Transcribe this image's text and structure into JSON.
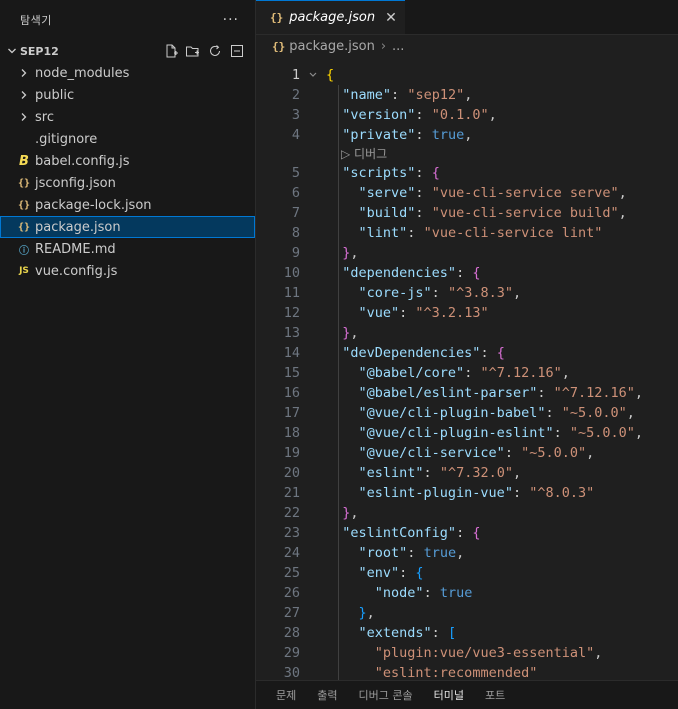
{
  "explorer": {
    "title": "탐색기",
    "more": "···",
    "folder": "SEP12",
    "items": [
      {
        "label": "node_modules",
        "icon": "chevron-right-icon",
        "glyph": "›",
        "kind": "folder"
      },
      {
        "label": "public",
        "icon": "chevron-right-icon",
        "glyph": "›",
        "kind": "folder"
      },
      {
        "label": "src",
        "icon": "chevron-right-icon",
        "glyph": "›",
        "kind": "folder"
      },
      {
        "label": ".gitignore",
        "icon": "",
        "glyph": "",
        "kind": "file"
      },
      {
        "label": "babel.config.js",
        "icon": "babel-icon",
        "glyph": "B",
        "kind": "babel"
      },
      {
        "label": "jsconfig.json",
        "icon": "json-icon",
        "glyph": "{}",
        "kind": "json"
      },
      {
        "label": "package-lock.json",
        "icon": "json-icon",
        "glyph": "{}",
        "kind": "json"
      },
      {
        "label": "package.json",
        "icon": "json-icon",
        "glyph": "{}",
        "kind": "json",
        "selected": true
      },
      {
        "label": "README.md",
        "icon": "info-icon",
        "glyph": "ⓘ",
        "kind": "info"
      },
      {
        "label": "vue.config.js",
        "icon": "js-icon",
        "glyph": "JS",
        "kind": "js"
      }
    ]
  },
  "editor": {
    "tab": {
      "label": "package.json",
      "icon_text": "{}",
      "close": "✕"
    },
    "breadcrumb": {
      "icon_text": "{}",
      "file": "package.json",
      "rest": "..."
    },
    "codelens": "▷ 디버그",
    "active_line": "1"
  },
  "panel": {
    "tabs": [
      "문제",
      "출력",
      "디버그 콘솔",
      "터미널",
      "포트"
    ],
    "active": "터미널"
  },
  "code_lines": [
    {
      "n": "1",
      "t": [
        [
          "br1",
          "{"
        ]
      ]
    },
    {
      "n": "2",
      "t": [
        [
          "p",
          "  "
        ],
        [
          "k",
          "\"name\""
        ],
        [
          "p",
          ": "
        ],
        [
          "s",
          "\"sep12\""
        ],
        [
          "p",
          ","
        ]
      ]
    },
    {
      "n": "3",
      "t": [
        [
          "p",
          "  "
        ],
        [
          "k",
          "\"version\""
        ],
        [
          "p",
          ": "
        ],
        [
          "s",
          "\"0.1.0\""
        ],
        [
          "p",
          ","
        ]
      ]
    },
    {
      "n": "4",
      "t": [
        [
          "p",
          "  "
        ],
        [
          "k",
          "\"private\""
        ],
        [
          "p",
          ": "
        ],
        [
          "b",
          "true"
        ],
        [
          "p",
          ","
        ]
      ]
    },
    {
      "lens": true
    },
    {
      "n": "5",
      "t": [
        [
          "p",
          "  "
        ],
        [
          "k",
          "\"scripts\""
        ],
        [
          "p",
          ": "
        ],
        [
          "br2",
          "{"
        ]
      ]
    },
    {
      "n": "6",
      "t": [
        [
          "p",
          "    "
        ],
        [
          "k",
          "\"serve\""
        ],
        [
          "p",
          ": "
        ],
        [
          "s",
          "\"vue-cli-service serve\""
        ],
        [
          "p",
          ","
        ]
      ]
    },
    {
      "n": "7",
      "t": [
        [
          "p",
          "    "
        ],
        [
          "k",
          "\"build\""
        ],
        [
          "p",
          ": "
        ],
        [
          "s",
          "\"vue-cli-service build\""
        ],
        [
          "p",
          ","
        ]
      ]
    },
    {
      "n": "8",
      "t": [
        [
          "p",
          "    "
        ],
        [
          "k",
          "\"lint\""
        ],
        [
          "p",
          ": "
        ],
        [
          "s",
          "\"vue-cli-service lint\""
        ]
      ]
    },
    {
      "n": "9",
      "t": [
        [
          "p",
          "  "
        ],
        [
          "br2",
          "}"
        ],
        [
          "p",
          ","
        ]
      ]
    },
    {
      "n": "10",
      "t": [
        [
          "p",
          "  "
        ],
        [
          "k",
          "\"dependencies\""
        ],
        [
          "p",
          ": "
        ],
        [
          "br2",
          "{"
        ]
      ]
    },
    {
      "n": "11",
      "t": [
        [
          "p",
          "    "
        ],
        [
          "k",
          "\"core-js\""
        ],
        [
          "p",
          ": "
        ],
        [
          "s",
          "\"^3.8.3\""
        ],
        [
          "p",
          ","
        ]
      ]
    },
    {
      "n": "12",
      "t": [
        [
          "p",
          "    "
        ],
        [
          "k",
          "\"vue\""
        ],
        [
          "p",
          ": "
        ],
        [
          "s",
          "\"^3.2.13\""
        ]
      ]
    },
    {
      "n": "13",
      "t": [
        [
          "p",
          "  "
        ],
        [
          "br2",
          "}"
        ],
        [
          "p",
          ","
        ]
      ]
    },
    {
      "n": "14",
      "t": [
        [
          "p",
          "  "
        ],
        [
          "k",
          "\"devDependencies\""
        ],
        [
          "p",
          ": "
        ],
        [
          "br2",
          "{"
        ]
      ]
    },
    {
      "n": "15",
      "t": [
        [
          "p",
          "    "
        ],
        [
          "k",
          "\"@babel/core\""
        ],
        [
          "p",
          ": "
        ],
        [
          "s",
          "\"^7.12.16\""
        ],
        [
          "p",
          ","
        ]
      ]
    },
    {
      "n": "16",
      "t": [
        [
          "p",
          "    "
        ],
        [
          "k",
          "\"@babel/eslint-parser\""
        ],
        [
          "p",
          ": "
        ],
        [
          "s",
          "\"^7.12.16\""
        ],
        [
          "p",
          ","
        ]
      ]
    },
    {
      "n": "17",
      "t": [
        [
          "p",
          "    "
        ],
        [
          "k",
          "\"@vue/cli-plugin-babel\""
        ],
        [
          "p",
          ": "
        ],
        [
          "s",
          "\"~5.0.0\""
        ],
        [
          "p",
          ","
        ]
      ]
    },
    {
      "n": "18",
      "t": [
        [
          "p",
          "    "
        ],
        [
          "k",
          "\"@vue/cli-plugin-eslint\""
        ],
        [
          "p",
          ": "
        ],
        [
          "s",
          "\"~5.0.0\""
        ],
        [
          "p",
          ","
        ]
      ]
    },
    {
      "n": "19",
      "t": [
        [
          "p",
          "    "
        ],
        [
          "k",
          "\"@vue/cli-service\""
        ],
        [
          "p",
          ": "
        ],
        [
          "s",
          "\"~5.0.0\""
        ],
        [
          "p",
          ","
        ]
      ]
    },
    {
      "n": "20",
      "t": [
        [
          "p",
          "    "
        ],
        [
          "k",
          "\"eslint\""
        ],
        [
          "p",
          ": "
        ],
        [
          "s",
          "\"^7.32.0\""
        ],
        [
          "p",
          ","
        ]
      ]
    },
    {
      "n": "21",
      "t": [
        [
          "p",
          "    "
        ],
        [
          "k",
          "\"eslint-plugin-vue\""
        ],
        [
          "p",
          ": "
        ],
        [
          "s",
          "\"^8.0.3\""
        ]
      ]
    },
    {
      "n": "22",
      "t": [
        [
          "p",
          "  "
        ],
        [
          "br2",
          "}"
        ],
        [
          "p",
          ","
        ]
      ]
    },
    {
      "n": "23",
      "t": [
        [
          "p",
          "  "
        ],
        [
          "k",
          "\"eslintConfig\""
        ],
        [
          "p",
          ": "
        ],
        [
          "br2",
          "{"
        ]
      ]
    },
    {
      "n": "24",
      "t": [
        [
          "p",
          "    "
        ],
        [
          "k",
          "\"root\""
        ],
        [
          "p",
          ": "
        ],
        [
          "b",
          "true"
        ],
        [
          "p",
          ","
        ]
      ]
    },
    {
      "n": "25",
      "t": [
        [
          "p",
          "    "
        ],
        [
          "k",
          "\"env\""
        ],
        [
          "p",
          ": "
        ],
        [
          "br3",
          "{"
        ]
      ]
    },
    {
      "n": "26",
      "t": [
        [
          "p",
          "      "
        ],
        [
          "k",
          "\"node\""
        ],
        [
          "p",
          ": "
        ],
        [
          "b",
          "true"
        ]
      ]
    },
    {
      "n": "27",
      "t": [
        [
          "p",
          "    "
        ],
        [
          "br3",
          "}"
        ],
        [
          "p",
          ","
        ]
      ]
    },
    {
      "n": "28",
      "t": [
        [
          "p",
          "    "
        ],
        [
          "k",
          "\"extends\""
        ],
        [
          "p",
          ": "
        ],
        [
          "br3",
          "["
        ]
      ]
    },
    {
      "n": "29",
      "t": [
        [
          "p",
          "      "
        ],
        [
          "s",
          "\"plugin:vue/vue3-essential\""
        ],
        [
          "p",
          ","
        ]
      ]
    },
    {
      "n": "30",
      "t": [
        [
          "p",
          "      "
        ],
        [
          "s",
          "\"eslint:recommended\""
        ]
      ]
    }
  ]
}
